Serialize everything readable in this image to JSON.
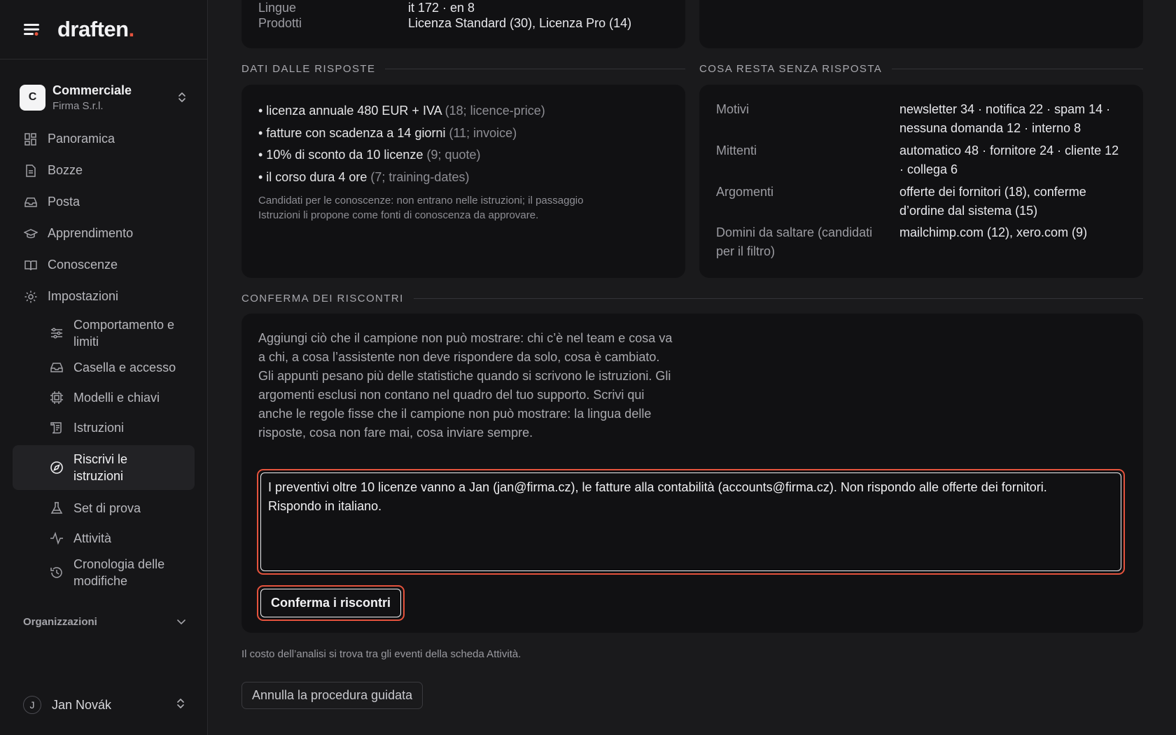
{
  "app": {
    "brand": "draften",
    "brand_dot": "."
  },
  "org": {
    "initial": "C",
    "name": "Commerciale",
    "company": "Firma S.r.l."
  },
  "nav": {
    "items": [
      {
        "label": "Panoramica",
        "icon": "grid-icon"
      },
      {
        "label": "Bozze",
        "icon": "file-icon"
      },
      {
        "label": "Posta",
        "icon": "inbox-icon"
      },
      {
        "label": "Apprendimento",
        "icon": "graduation-cap-icon"
      },
      {
        "label": "Conoscenze",
        "icon": "book-icon"
      },
      {
        "label": "Impostazioni",
        "icon": "gear-icon"
      }
    ],
    "sub_items": [
      {
        "label": "Comportamento e limiti",
        "icon": "sliders-icon"
      },
      {
        "label": "Casella e accesso",
        "icon": "inbox-icon"
      },
      {
        "label": "Modelli e chiavi",
        "icon": "chip-icon"
      },
      {
        "label": "Istruzioni",
        "icon": "scroll-icon"
      },
      {
        "label": "Riscrivi le istruzioni",
        "icon": "compass-icon",
        "active": true
      },
      {
        "label": "Set di prova",
        "icon": "flask-icon"
      },
      {
        "label": "Attività",
        "icon": "activity-icon"
      },
      {
        "label": "Cronologia delle modifiche",
        "icon": "history-icon"
      }
    ],
    "orgs_label": "Organizzazioni"
  },
  "user": {
    "initial": "J",
    "name": "Jan Novák"
  },
  "top_card": {
    "rows": [
      {
        "key": "Lingue",
        "value": "it 172 · en 8"
      },
      {
        "key": "Prodotti",
        "value": "Licenza Standard (30), Licenza Pro (14)"
      }
    ]
  },
  "answers": {
    "title": "DATI DALLE RISPOSTE",
    "bullets": [
      {
        "text": "• licenza annuale 480 EUR + IVA",
        "meta": "(18; licence-price)"
      },
      {
        "text": "• fatture con scadenza a 14 giorni",
        "meta": "(11; invoice)"
      },
      {
        "text": "• 10% di sconto da 10 licenze",
        "meta": "(9; quote)"
      },
      {
        "text": "• il corso dura 4 ore",
        "meta": "(7; training-dates)"
      }
    ],
    "note_line1": "Candidati per le conoscenze: non entrano nelle istruzioni; il passaggio",
    "note_line2": "Istruzioni li propone come fonti di conoscenza da approvare."
  },
  "unanswered": {
    "title": "COSA RESTA SENZA RISPOSTA",
    "rows": [
      {
        "key": "Motivi",
        "value1": "newsletter 34 · notifica 22 · spam 14 ·",
        "value2": "nessuna domanda 12 · interno 8"
      },
      {
        "key": "Mittenti",
        "value1": "automatico 48 · fornitore 24 · cliente 12",
        "value2": "· collega 6"
      },
      {
        "key": "Argomenti",
        "value1": "offerte dei fornitori (18), conferme",
        "value2": "d’ordine dal sistema (15)"
      },
      {
        "key1": "Domini da saltare (candidati",
        "key2": "per il filtro)",
        "value1": "mailchimp.com (12), xero.com (9)"
      }
    ]
  },
  "confirm": {
    "title": "CONFERMA DEI RISCONTRI",
    "intro": "Aggiungi ciò che il campione non può mostrare: chi c’è nel team e cosa va a chi, a cosa l’assistente non deve rispondere da solo, cosa è cambiato. Gli appunti pesano più delle statistiche quando si scrivono le istruzioni. Gli argomenti esclusi non contano nel quadro del tuo supporto. Scrivi qui anche le regole fisse che il campione non può mostrare: la lingua delle risposte, cosa non fare mai, cosa inviare sempre.",
    "textarea_value": "I preventivi oltre 10 licenze vanno a Jan (jan@firma.cz), le fatture alla contabilità (accounts@firma.cz). Non rispondo alle offerte dei fornitori.\nRispondo in italiano.",
    "button_label": "Conferma i riscontri"
  },
  "footer": {
    "note": "Il costo dell’analisi si trova tra gli eventi della scheda Attività.",
    "cancel_label": "Annulla la procedura guidata"
  },
  "colors": {
    "accent": "#e5533d",
    "background": "#1a1a1c",
    "card": "#111113",
    "sidebar": "#161618"
  }
}
